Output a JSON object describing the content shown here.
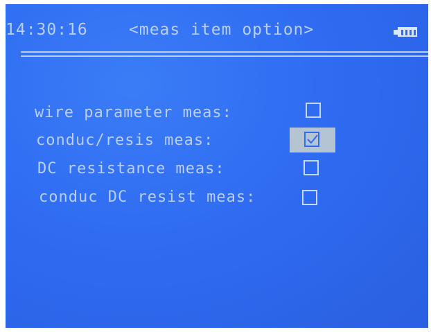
{
  "header": {
    "time": "14:30:16",
    "title": "<meas item option>"
  },
  "status": {
    "battery_icon": "battery-full-icon",
    "battery_level": 1.0
  },
  "options": [
    {
      "label": "wire parameter meas:",
      "checked": false
    },
    {
      "label": "conduc/resis meas:",
      "checked": true
    },
    {
      "label": "DC resistance meas:",
      "checked": false
    },
    {
      "label": "conduc DC resist meas:",
      "checked": false
    }
  ],
  "colors": {
    "screen_bg": "#2f6cf2",
    "text": "#b9cff8",
    "highlight": "#b4c4d2"
  }
}
